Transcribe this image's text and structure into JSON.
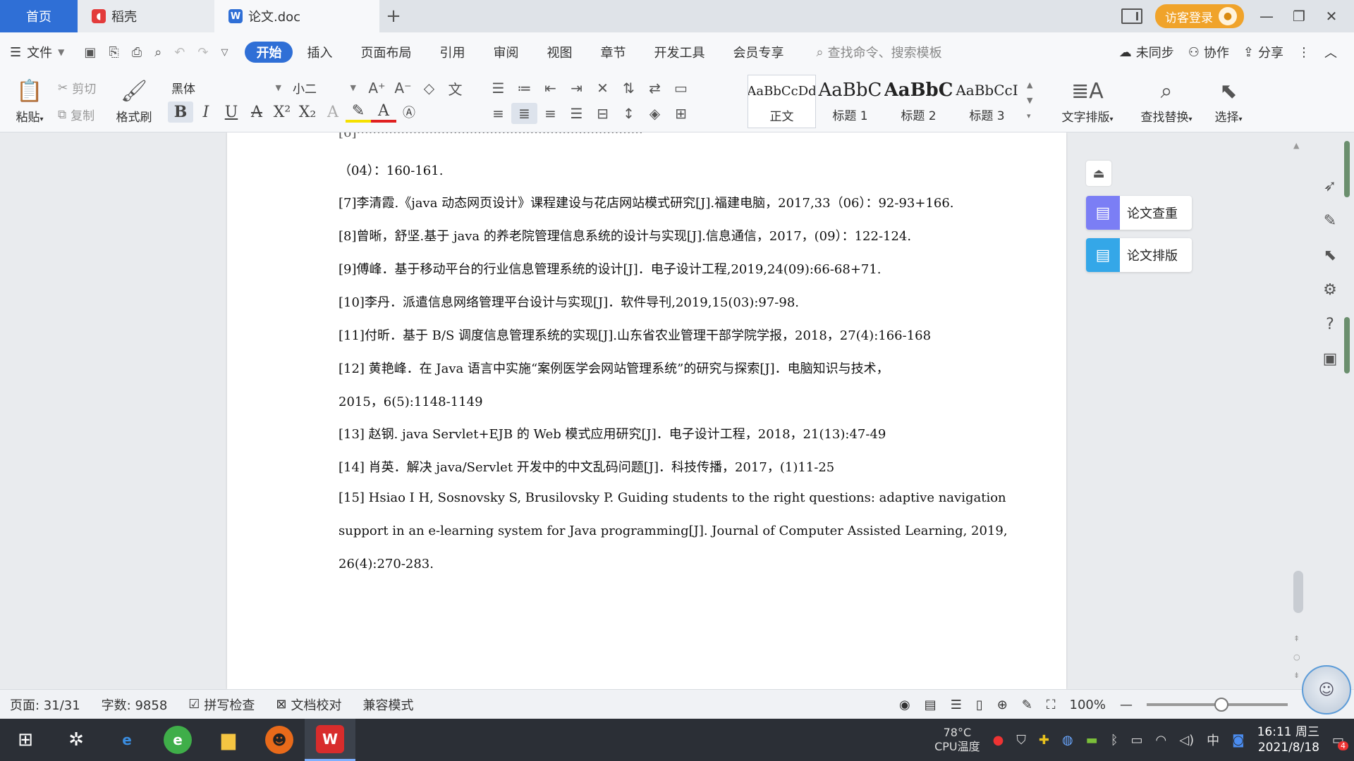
{
  "titlebar": {
    "tabs": [
      {
        "label": "首页"
      },
      {
        "label": "稻壳"
      },
      {
        "label": "论文.doc"
      }
    ],
    "add_tab": "+",
    "visitor_login": "访客登录"
  },
  "menubar": {
    "file": "文件",
    "tabs": [
      "开始",
      "插入",
      "页面布局",
      "引用",
      "审阅",
      "视图",
      "章节",
      "开发工具",
      "会员专享"
    ],
    "search_placeholder": "查找命令、搜索模板",
    "right": {
      "sync": "未同步",
      "collab": "协作",
      "share": "分享"
    }
  },
  "ribbon": {
    "paste": "粘贴",
    "cut": "剪切",
    "copy": "复制",
    "format_painter": "格式刷",
    "font_name": "黑体",
    "font_size": "小二",
    "styles": [
      {
        "preview": "AaBbCcDd",
        "name": "正文"
      },
      {
        "preview": "AaBbC",
        "name": "标题 1"
      },
      {
        "preview": "AaBbC",
        "name": "标题 2"
      },
      {
        "preview": "AaBbCcI",
        "name": "标题 3"
      }
    ],
    "text_layout": "文字排版",
    "find_replace": "查找替换",
    "select": "选择"
  },
  "document": {
    "refs": [
      "（04）：160-161.",
      "[7]李清霞.《java 动态网页设计》课程建设与花店网站模式研究[J].福建电脑，2017,33（06）：92-93+166.",
      "[8]曾晰，舒坚.基于 java 的养老院管理信息系统的设计与实现[J].信息通信，2017，(09）：122-124.",
      "[9]傅峰．基于移动平台的行业信息管理系统的设计[J]．电子设计工程,2019,24(09):66-68+71.",
      "[10]李丹．派遣信息网络管理平台设计与实现[J]．软件导刊,2019,15(03):97-98.",
      "[11]付昕．基于 B/S 调度信息管理系统的实现[J].山东省农业管理干部学院学报，2018，27(4):166-168",
      "[12]  黄艳峰．在 Java 语言中实施“案例医学会网站管理系统”的研究与探索[J]．电脑知识与技术，",
      "2015，6(5):1148-1149",
      "[13]  赵钢. java Servlet+EJB 的 Web 模式应用研究[J]．电子设计工程，2018，21(13):47-49",
      "[14]  肖英．解决 java/Servlet 开发中的中文乱码问题[J]．科技传播，2017，(1)11-25",
      "[15] Hsiao I H, Sosnovsky S, Brusilovsky P. Guiding students to the right questions: adaptive navigation",
      "support in an e-learning system for Java programming[J]. Journal of Computer Assisted Learning, 2019,",
      "26(4):270-283."
    ]
  },
  "side_panel": {
    "check": "论文查重",
    "format": "论文排版"
  },
  "statusbar": {
    "page": "页面: 31/31",
    "words": "字数: 9858",
    "spell": "拼写检查",
    "proof": "文档校对",
    "compat": "兼容模式",
    "zoom": "100%"
  },
  "taskbar": {
    "cpu_temp": "78°C",
    "cpu_label": "CPU温度",
    "ime": "中",
    "time": "16:11 周三",
    "date": "2021/8/18",
    "notify_count": "4"
  },
  "colors": {
    "accent": "#2f6fd6",
    "visitor": "#f0a32a",
    "taskbar": "#2b2f36"
  }
}
